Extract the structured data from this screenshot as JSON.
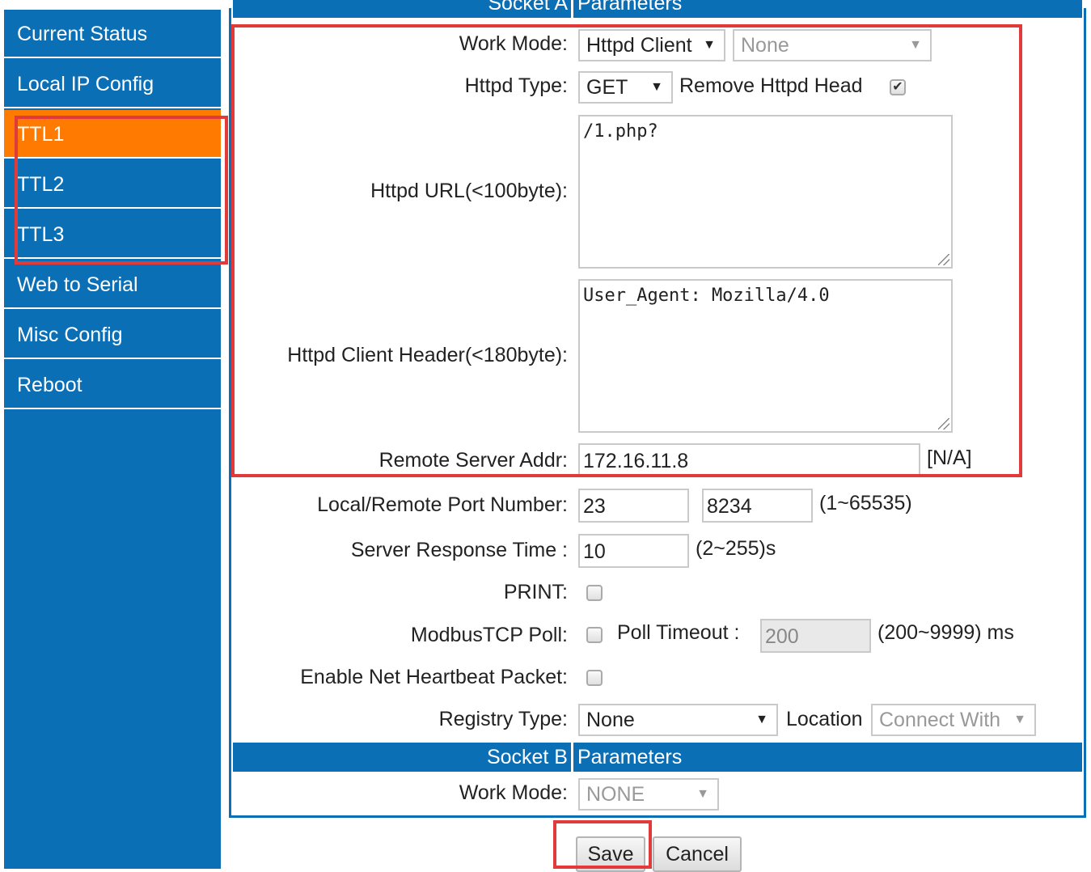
{
  "sidebar": {
    "items": [
      {
        "label": "Current Status"
      },
      {
        "label": "Local IP Config"
      },
      {
        "label": "TTL1"
      },
      {
        "label": "TTL2"
      },
      {
        "label": "TTL3"
      },
      {
        "label": "Web to Serial"
      },
      {
        "label": "Misc Config"
      },
      {
        "label": "Reboot"
      }
    ],
    "active_color": "#ff7a00",
    "bg_color": "#0b6fb6"
  },
  "socket_a": {
    "header_left": "Socket A",
    "header_right": "Parameters",
    "work_mode_label": "Work Mode:",
    "work_mode_value": "Httpd Client",
    "work_mode_sub_value": "None",
    "httpd_type_label": "Httpd Type:",
    "httpd_type_value": "GET",
    "remove_head_label": "Remove Httpd Head",
    "remove_head_checked": "✔",
    "url_label": "Httpd URL(<100byte):",
    "url_value": "/1.php?",
    "header_label": "Httpd Client Header(<180byte):",
    "header_value": "User_Agent: Mozilla/4.0",
    "server_addr_label": "Remote Server Addr:",
    "server_addr_value": "172.16.11.8",
    "server_addr_hint": "[N/A]",
    "port_label": "Local/Remote Port Number:",
    "local_port": "23",
    "remote_port": "8234",
    "port_hint": "(1~65535)",
    "response_label": "Server Response Time :",
    "response_value": "10",
    "response_hint": "(2~255)s",
    "print_label": "PRINT:",
    "modbus_label": "ModbusTCP Poll:",
    "poll_timeout_label": "Poll Timeout :",
    "poll_timeout_value": "200",
    "poll_timeout_hint": "(200~9999) ms",
    "heartbeat_label": "Enable Net Heartbeat Packet:",
    "registry_label": "Registry Type:",
    "registry_value": "None",
    "location_label": "Location",
    "location_value": "Connect With"
  },
  "socket_b": {
    "header_left": "Socket B",
    "header_right": "Parameters",
    "work_mode_label": "Work Mode:",
    "work_mode_value": "NONE"
  },
  "buttons": {
    "save": "Save",
    "cancel": "Cancel"
  },
  "highlight_color": "#e03a3a"
}
